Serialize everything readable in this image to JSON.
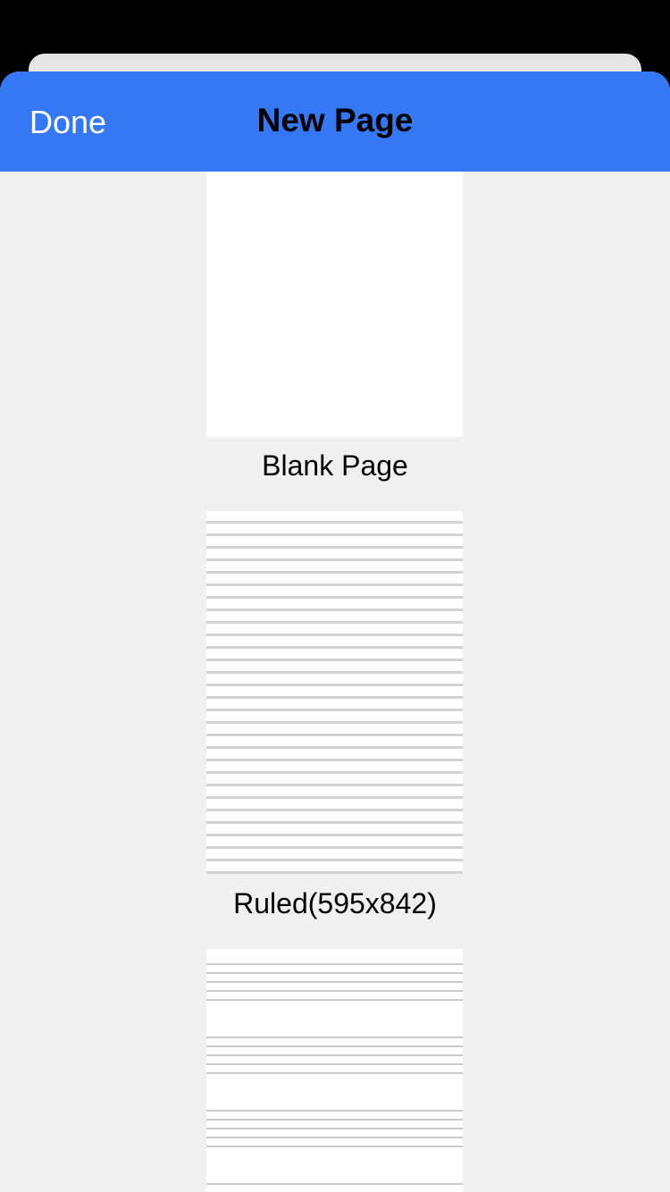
{
  "nav": {
    "done_label": "Done",
    "title": "New Page"
  },
  "templates": [
    {
      "label": "Blank Page",
      "pattern": "blank"
    },
    {
      "label": "Ruled(595x842)",
      "pattern": "ruled"
    },
    {
      "label": "",
      "pattern": "music-staff"
    }
  ],
  "colors": {
    "nav_background": "#3478f6",
    "sheet_background": "#f0f0f0",
    "line_color": "#d2d2d2"
  }
}
